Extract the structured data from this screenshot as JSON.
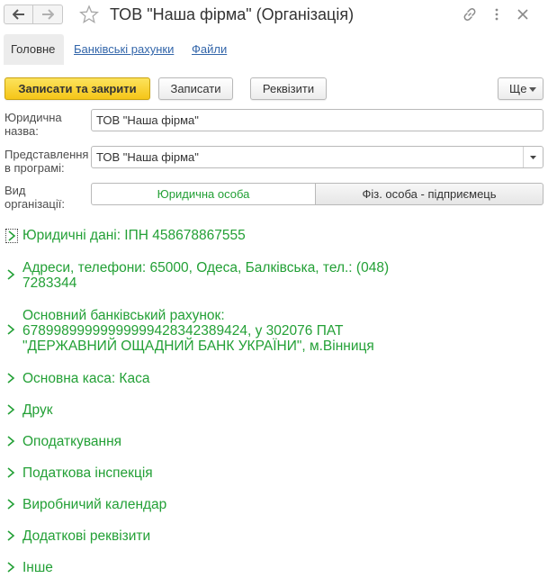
{
  "window": {
    "title": "ТОВ \"Наша фірма\" (Організація)",
    "icons": [
      "back-arrow-icon",
      "forward-arrow-icon",
      "star-icon",
      "link-icon",
      "more-vertical-icon",
      "close-icon"
    ]
  },
  "tabs": [
    {
      "label": "Головне"
    },
    {
      "label": "Банківські рахунки"
    },
    {
      "label": "Файли"
    }
  ],
  "toolbar": {
    "save_close_label": "Записати та закрити",
    "save_label": "Записати",
    "requisites_label": "Реквізити",
    "more_label": "Ще"
  },
  "form": {
    "legal_name_label_1": "Юридична",
    "legal_name_label_2": "назва:",
    "legal_name_value": "ТОВ \"Наша фірма\"",
    "display_label_1": "Представлення",
    "display_label_2": "в програмі:",
    "display_value": "ТОВ \"Наша фірма\"",
    "org_type_label_1": "Вид",
    "org_type_label_2": "організації:",
    "org_type_options": [
      "Юридична особа",
      "Фіз. особа - підприємець"
    ]
  },
  "groups": {
    "legal": "Юридичні дані: ІПН 458678867555",
    "address_1": "Адреси, телефони: 65000, Одеса, Балківська, тел.: (048)",
    "address_2": "7283344",
    "bank_1": "Основний банківський рахунок:",
    "bank_2": "67899899999999999428342389424, у 302076 ПАТ",
    "bank_3": "\"ДЕРЖАВНИЙ ОЩАДНИЙ БАНК УКРАЇНИ\", м.Вінниця",
    "cash": "Основна каса: Каса",
    "print": "Друк",
    "tax": "Оподаткування",
    "inspection": "Податкова інспекція",
    "calendar": "Виробничий календар",
    "extra": "Додаткові реквізити",
    "other": "Інше"
  },
  "colors": {
    "accent_green": "#23a036",
    "link_blue": "#3366aa",
    "primary_button": "#f5c518"
  }
}
